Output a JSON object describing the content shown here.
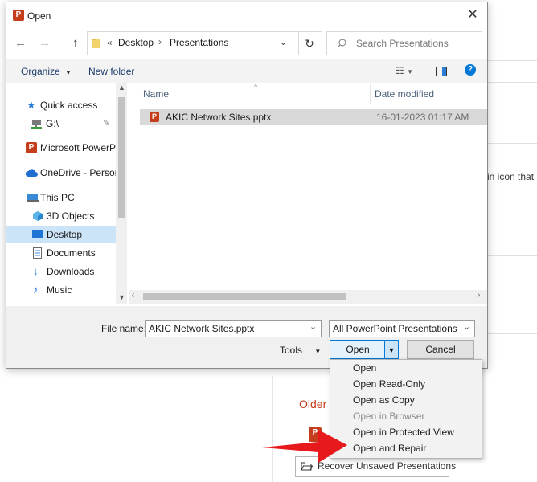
{
  "dialog": {
    "title": "Open",
    "nav": {
      "path_overflow": "«",
      "path": [
        "Desktop",
        "Presentations"
      ],
      "search_placeholder": "Search Presentations"
    },
    "toolbar": {
      "organize": "Organize",
      "new_folder": "New folder"
    },
    "sidebar": {
      "items": [
        {
          "label": "Quick access",
          "icon": "star-icon"
        },
        {
          "label": "G:\\",
          "icon": "network-drive-icon"
        },
        {
          "label": "Microsoft PowerPoint",
          "icon": "powerpoint-icon"
        },
        {
          "label": "OneDrive - Personal",
          "icon": "cloud-icon"
        },
        {
          "label": "This PC",
          "icon": "computer-icon"
        },
        {
          "label": "3D Objects",
          "icon": "cube-icon"
        },
        {
          "label": "Desktop",
          "icon": "desktop-icon",
          "selected": true
        },
        {
          "label": "Documents",
          "icon": "document-icon"
        },
        {
          "label": "Downloads",
          "icon": "download-icon"
        },
        {
          "label": "Music",
          "icon": "music-icon"
        }
      ]
    },
    "columns": {
      "name": "Name",
      "date_modified": "Date modified"
    },
    "files": [
      {
        "name": "AKIC Network Sites.pptx",
        "date": "16-01-2023 01:17 AM",
        "icon": "pptx-file-icon"
      }
    ],
    "filename_label": "File name:",
    "filename_value": "AKIC Network Sites.pptx",
    "filetype_value": "All PowerPoint Presentations (*.p",
    "tools_label": "Tools",
    "open_label": "Open",
    "cancel_label": "Cancel"
  },
  "open_menu": {
    "items": [
      {
        "label": "Open",
        "enabled": true
      },
      {
        "label": "Open Read-Only",
        "enabled": true
      },
      {
        "label": "Open as Copy",
        "enabled": true
      },
      {
        "label": "Open in Browser",
        "enabled": false
      },
      {
        "label": "Open in Protected View",
        "enabled": true
      },
      {
        "label": "Open and Repair",
        "enabled": true
      }
    ]
  },
  "background": {
    "fragment_text": "in icon that",
    "older_heading": "Older",
    "recover_button": "Recover Unsaved Presentations"
  },
  "colors": {
    "accent": "#0078d7",
    "selection": "#cce4f7",
    "powerpoint": "#c43e1c",
    "annotation_arrow": "#e8191c"
  }
}
